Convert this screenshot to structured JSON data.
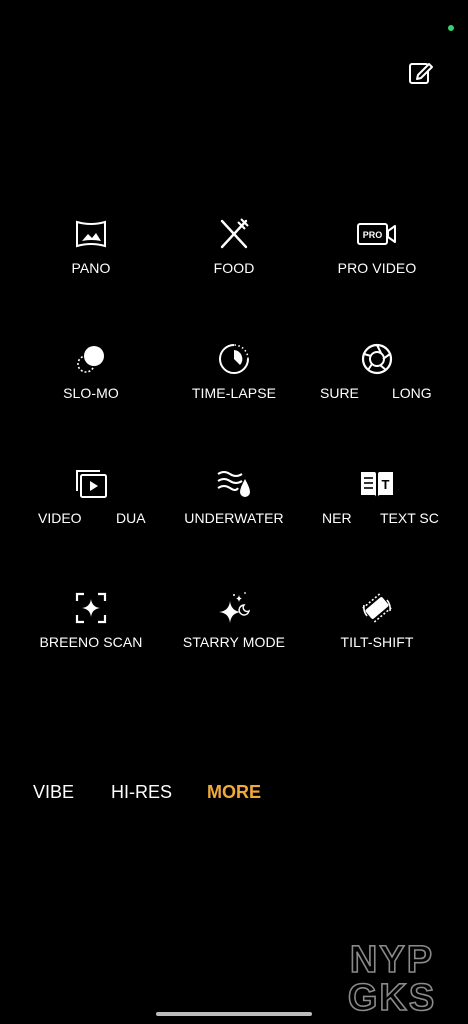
{
  "modes": [
    {
      "label": "PANO",
      "icon": "pano-icon"
    },
    {
      "label": "FOOD",
      "icon": "fork-knife-icon"
    },
    {
      "label": "PRO VIDEO",
      "icon": "pro-video-icon",
      "badge": "PRO"
    },
    {
      "label": "SLO-MO",
      "icon": "slo-mo-icon"
    },
    {
      "label": "TIME-LAPSE",
      "icon": "time-lapse-icon"
    },
    {
      "label_left": "SURE",
      "label_right": "LONG",
      "icon": "aperture-icon"
    },
    {
      "label_left": "VIDEO",
      "label_right": "DUA",
      "icon": "dual-video-icon"
    },
    {
      "label": "UNDERWATER",
      "icon": "underwater-icon"
    },
    {
      "label_left": "NER",
      "label_right": "TEXT SC",
      "icon": "text-scanner-icon",
      "badge": "T"
    },
    {
      "label": "BREENO SCAN",
      "icon": "breeno-scan-icon"
    },
    {
      "label": "STARRY MODE",
      "icon": "starry-mode-icon"
    },
    {
      "label": "TILT-SHIFT",
      "icon": "tilt-shift-icon"
    }
  ],
  "tabs": [
    {
      "label": "VIBE",
      "active": false
    },
    {
      "label": "HI-RES",
      "active": false
    },
    {
      "label": "MORE",
      "active": true
    }
  ],
  "watermark": {
    "line1": "NYP",
    "line2": "GKS"
  },
  "colors": {
    "background": "#000000",
    "accent": "#f1a93b",
    "status_dot": "#36d36c"
  }
}
